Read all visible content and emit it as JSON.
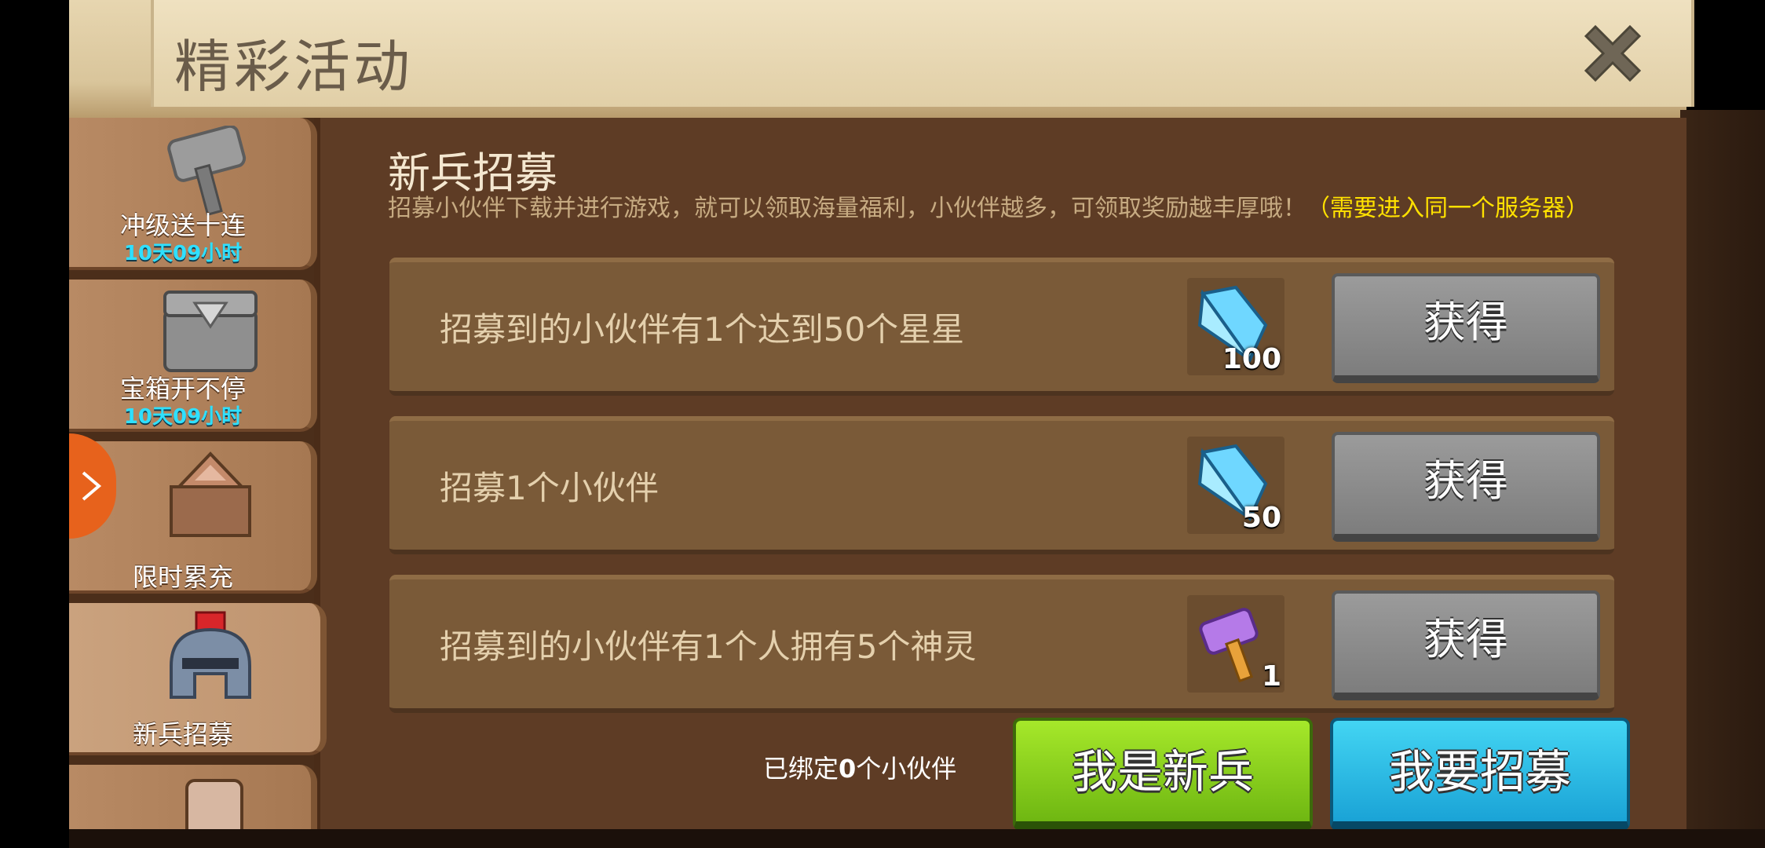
{
  "header": {
    "title": "精彩活动"
  },
  "sidebar": {
    "tabs": [
      {
        "label": "冲级送十连",
        "timer": "10天09小时",
        "icon": "hammer-icon"
      },
      {
        "label": "宝箱开不停",
        "timer": "10天09小时",
        "icon": "chest-icon"
      },
      {
        "label": "限时累充",
        "icon": "crate-icon"
      },
      {
        "label": "新兵招募",
        "icon": "helmet-icon",
        "active": true
      }
    ]
  },
  "section": {
    "title": "新兵招募",
    "desc_main": "招募小伙伴下载并进行游戏，就可以领取海量福利，小伙伴越多，可领取奖励越丰厚哦！",
    "desc_highlight": "（需要进入同一个服务器）"
  },
  "rows": [
    {
      "text": "招募到的小伙伴有1个达到50个星星",
      "reward": "diamond-icon",
      "count": "100",
      "button": "获得"
    },
    {
      "text": "招募1个小伙伴",
      "reward": "diamond-icon",
      "count": "50",
      "button": "获得"
    },
    {
      "text": "招募到的小伙伴有1个人拥有5个神灵",
      "reward": "purple-hammer-icon",
      "count": "1",
      "button": "获得"
    }
  ],
  "footer": {
    "bound_prefix": "已绑定",
    "bound_count": "0",
    "bound_suffix": "个小伙伴",
    "newbie_button": "我是新兵",
    "recruit_button": "我要招募"
  },
  "colors": {
    "accent_green": "#8fd21e",
    "accent_blue": "#2bbde8",
    "highlight": "#ffe100"
  }
}
